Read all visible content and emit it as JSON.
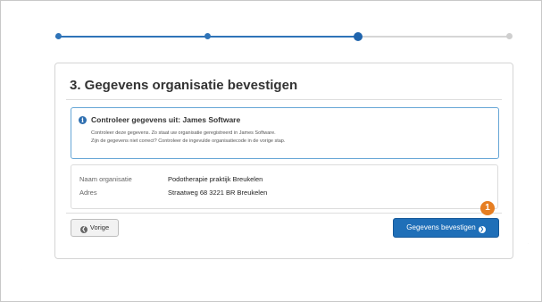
{
  "step": {
    "title": "3. Gegevens organisatie bevestigen"
  },
  "info": {
    "heading": "Controleer gegevens uit: James Software",
    "line1": "Controleer deze gegevens. Zo staat uw organisatie geregistreerd in James Software.",
    "line2": "Zijn de gegevens niet correct? Controleer de ingevulde organisatiecode in de vorige stap."
  },
  "details": [
    {
      "label": "Naam organisatie",
      "value": "Podotherapie praktijk Breukelen"
    },
    {
      "label": "Adres",
      "value": "Straatweg 68 3221 BR Breukelen"
    }
  ],
  "buttons": {
    "back_label": "Vorige",
    "confirm_label": "Gegevens bevestigen"
  },
  "callout": {
    "number": "1"
  },
  "colors": {
    "accent": "#1f6fb8",
    "callout": "#e67e22"
  },
  "icons": {
    "info": "info-icon",
    "back": "chevron-left-circle-icon",
    "confirm": "chevron-right-circle-icon"
  }
}
